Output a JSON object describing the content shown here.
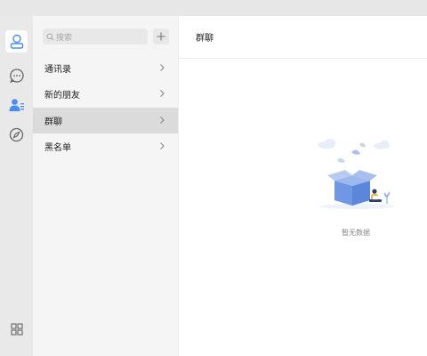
{
  "rail": {
    "items": [
      {
        "icon": "contacts-profile-icon",
        "active": true
      },
      {
        "icon": "chat-bubble-icon",
        "active": false
      },
      {
        "icon": "contacts-list-icon",
        "active": false
      },
      {
        "icon": "compass-icon",
        "active": false
      }
    ],
    "bottom_icon": "grid-apps-icon",
    "active_color": "#4a8cf7"
  },
  "search": {
    "placeholder": "搜索"
  },
  "menu": {
    "items": [
      {
        "label": "通讯录",
        "selected": false
      },
      {
        "label": "新的朋友",
        "selected": false
      },
      {
        "label": "群聊",
        "selected": true
      },
      {
        "label": "黑名单",
        "selected": false
      }
    ]
  },
  "content": {
    "title": "群聊",
    "empty_text": "暂无数据"
  }
}
